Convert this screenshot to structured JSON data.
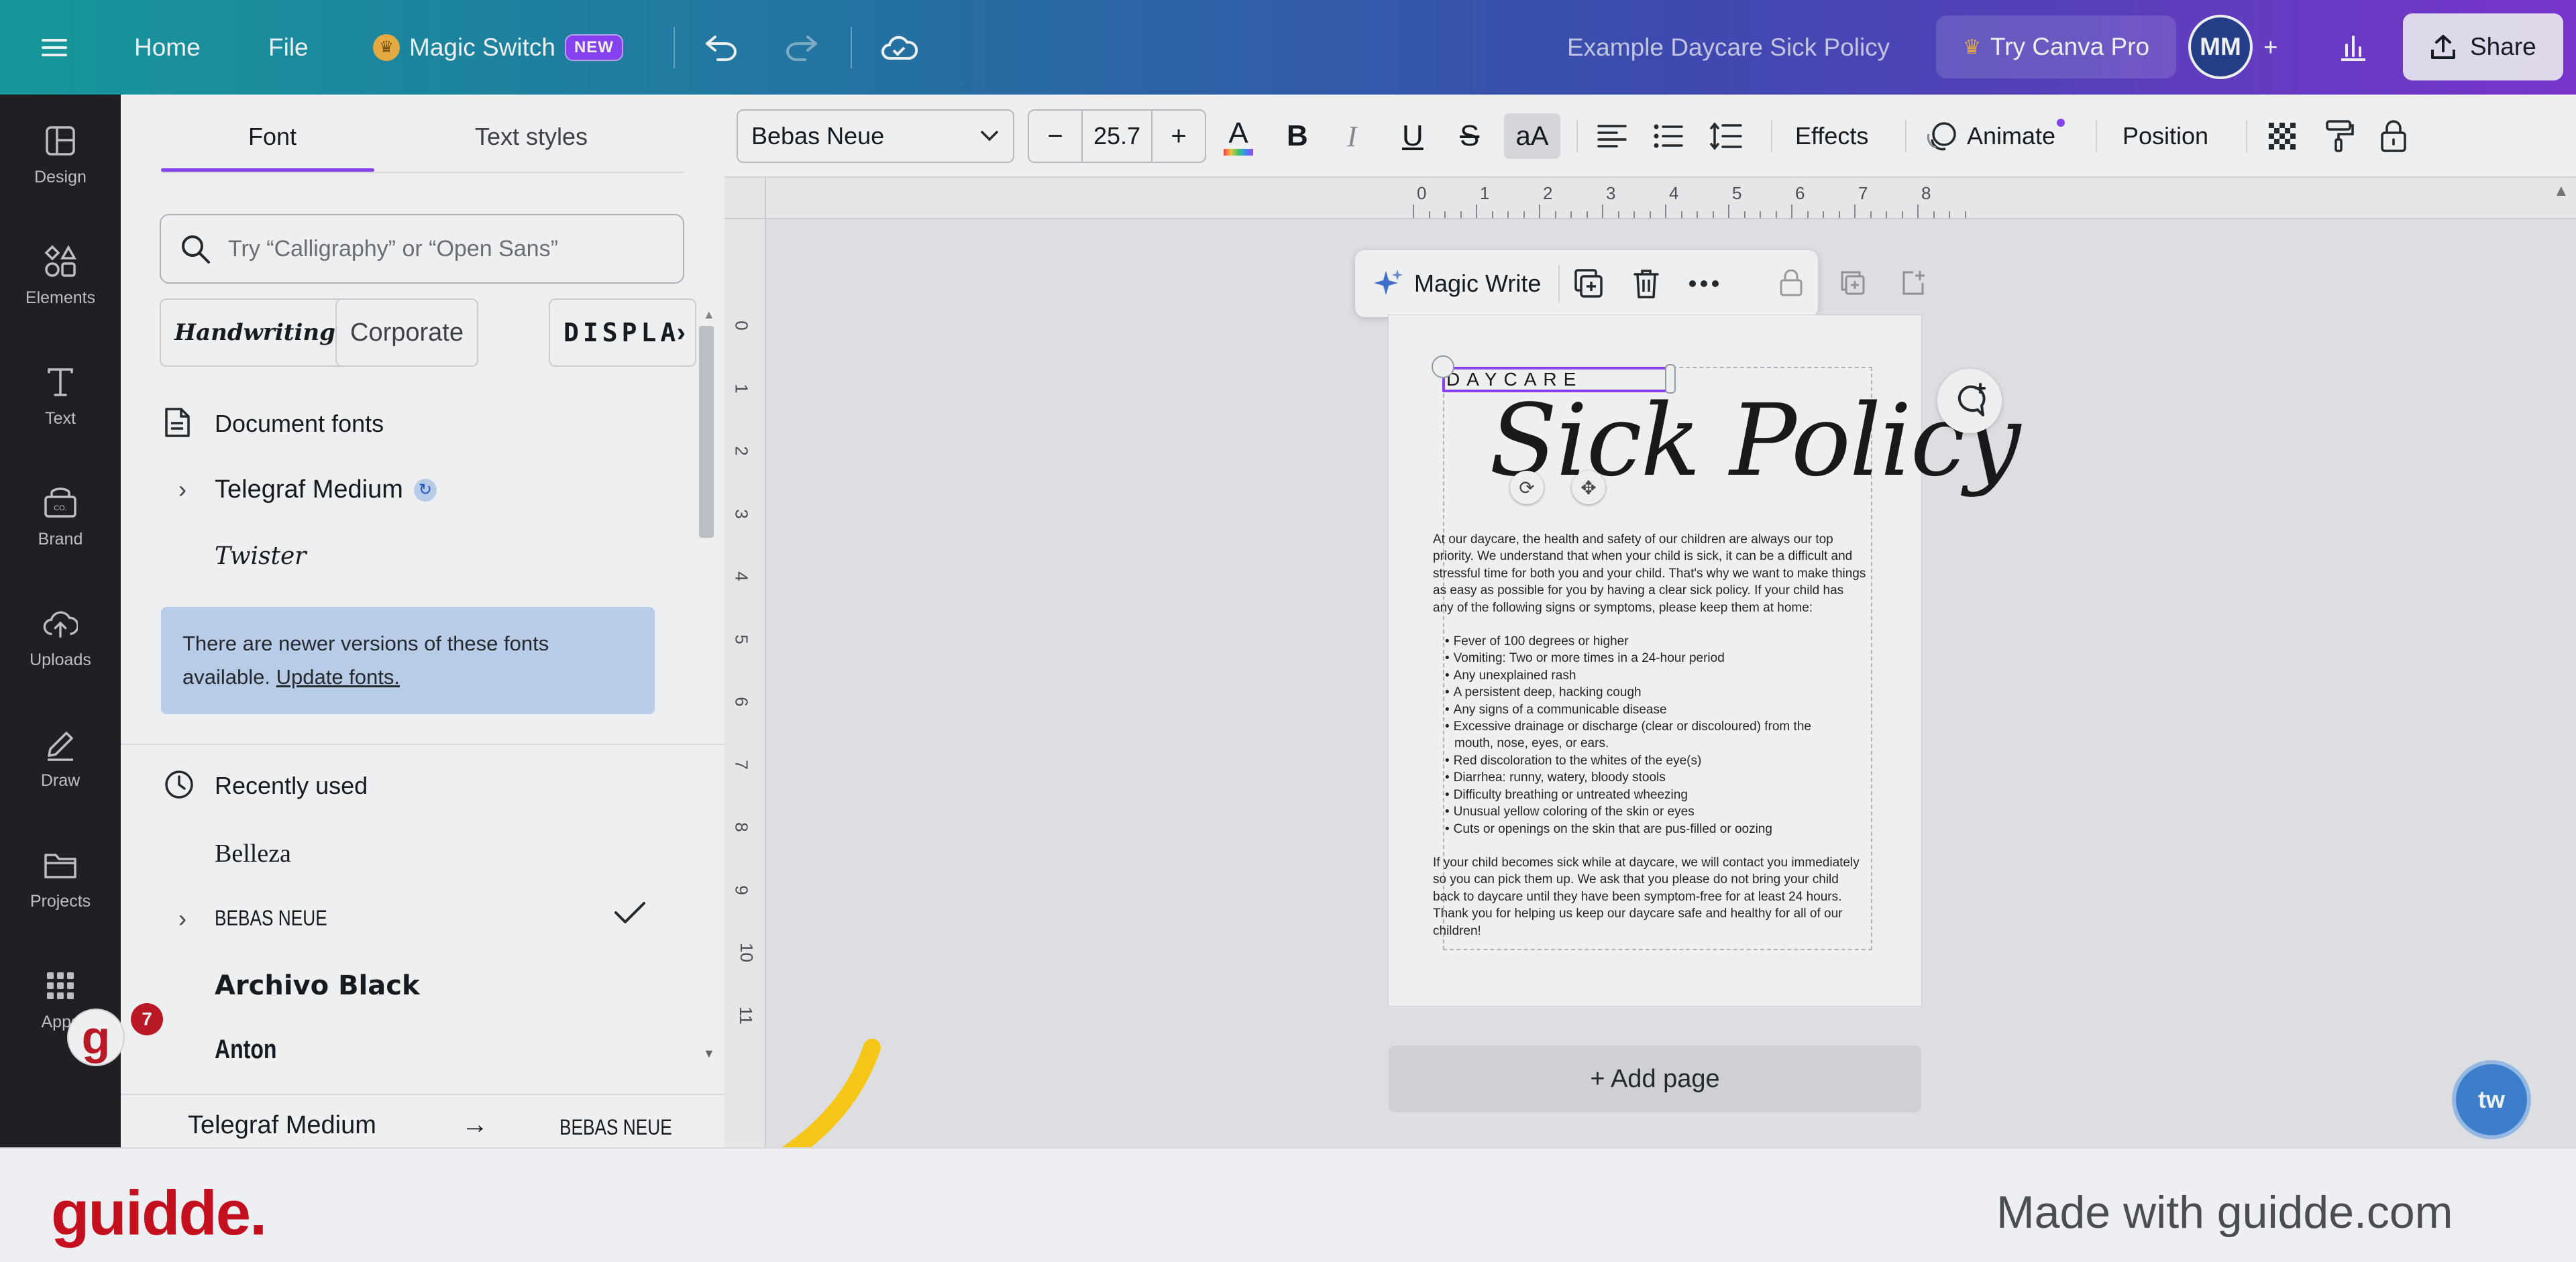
{
  "topbar": {
    "home": "Home",
    "file": "File",
    "magic_switch": "Magic Switch",
    "magic_badge": "NEW",
    "doc_title": "Example Daycare Sick Policy",
    "try_pro": "Try Canva Pro",
    "avatar_initials": "MM",
    "share": "Share"
  },
  "rail": {
    "items": [
      {
        "label": "Design",
        "icon": "layout-icon"
      },
      {
        "label": "Elements",
        "icon": "shapes-icon"
      },
      {
        "label": "Text",
        "icon": "text-icon"
      },
      {
        "label": "Brand",
        "icon": "brand-icon"
      },
      {
        "label": "Uploads",
        "icon": "cloud-upload-icon"
      },
      {
        "label": "Draw",
        "icon": "pen-icon"
      },
      {
        "label": "Projects",
        "icon": "folder-icon"
      },
      {
        "label": "Apps",
        "icon": "grid-icon"
      }
    ]
  },
  "panel": {
    "tab_font": "Font",
    "tab_styles": "Text styles",
    "search_placeholder": "Try “Calligraphy” or “Open Sans”",
    "chips": [
      "Handwriting",
      "Corporate",
      "DISPLA"
    ],
    "document_fonts_title": "Document fonts",
    "document_fonts": [
      "Telegraf Medium",
      "Twister"
    ],
    "note_text": "There are newer versions of these fonts available.",
    "note_link": "Update fonts.",
    "recent_title": "Recently used",
    "recent_fonts": [
      "Belleza",
      "BEBAS NEUE",
      "Archivo Black",
      "Anton"
    ],
    "replace_from": "Telegraf Medium",
    "replace_to": "BEBAS NEUE",
    "notification_count": "7"
  },
  "toolbar": {
    "font_name": "Bebas Neue",
    "font_size": "25.7",
    "effects": "Effects",
    "animate": "Animate",
    "position": "Position"
  },
  "canvas": {
    "ruler_top": [
      "0",
      "1",
      "2",
      "3",
      "4",
      "5",
      "6",
      "7",
      "8"
    ],
    "ruler_left": [
      "0",
      "1",
      "2",
      "3",
      "4",
      "5",
      "6",
      "7",
      "8",
      "9",
      "10",
      "11"
    ],
    "ctx_magic_write": "Magic Write",
    "daycare_label": "DAYCARE",
    "title": "Sick Policy",
    "intro": "At our daycare, the health and safety of our children are always our top priority. We understand that when your child is sick, it can be a difficult and stressful time for both you and your child. That's why we want to make things as easy as possible for you by having a clear sick policy. If your child has any of the following signs or symptoms, please keep them at home:",
    "symptoms": [
      "Fever of 100 degrees or higher",
      "Vomiting:  Two or more times in a 24-hour period",
      "Any unexplained rash",
      "A persistent deep, hacking cough",
      "Any signs of a communicable disease",
      "Excessive drainage or discharge (clear or discoloured) from the",
      "mouth, nose, eyes, or ears.",
      "Red discoloration to the whites of the eye(s)",
      "Diarrhea: runny, watery, bloody stools",
      "Difficulty breathing or untreated wheezing",
      "Unusual yellow coloring of the skin or eyes",
      "Cuts or openings on the skin that are pus-filled or oozing"
    ],
    "closing": "If your child becomes sick while at daycare, we will contact you immediately so you can pick them up. We ask that you please do not bring your child back to daycare until they have been symptom-free for at least 24 hours. Thank you for helping us keep our daycare safe and healthy for all of our children!",
    "add_page": "+ Add page",
    "help_label": "tw"
  },
  "footer": {
    "logo": "guidde.",
    "made_with": "Made with guidde.com"
  },
  "colors": {
    "accent": "#8b3dff",
    "brand_red": "#c4101e",
    "topbar_start": "#0f9ea0",
    "topbar_end": "#7b2fd6"
  }
}
